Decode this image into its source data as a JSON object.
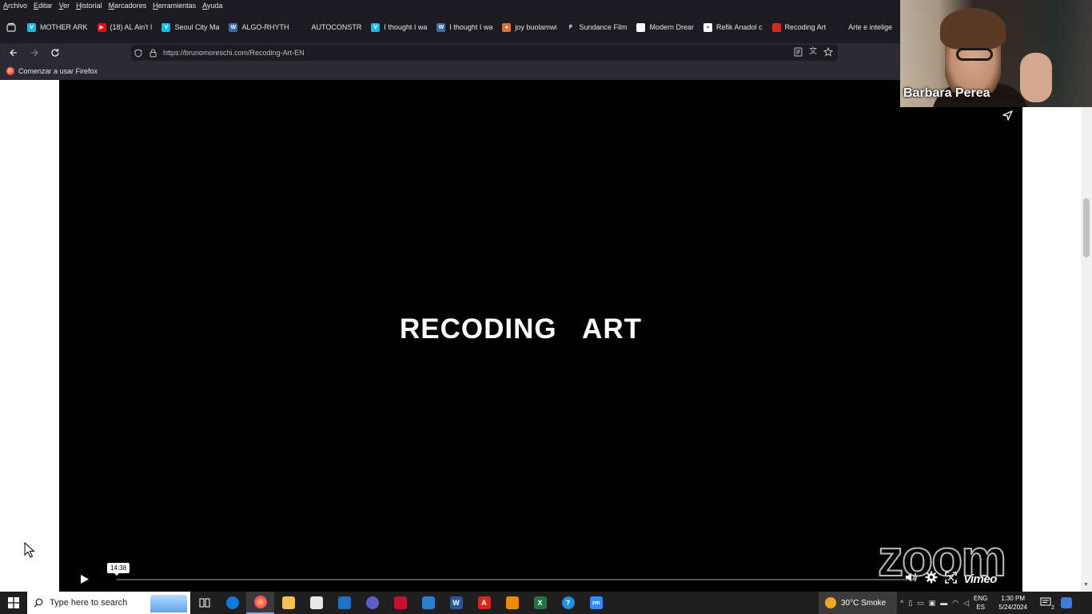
{
  "browser": {
    "menu": [
      "Archivo",
      "Editar",
      "Ver",
      "Historial",
      "Marcadores",
      "Herramientas",
      "Ayuda"
    ],
    "tabs": [
      {
        "label": "MOTHER ARK",
        "icon": "vimeo-icon",
        "color": "#1ab7ea",
        "glyph": "V"
      },
      {
        "label": "(18) AL Ain't I",
        "icon": "youtube-icon",
        "color": "#ff0000",
        "glyph": "▶"
      },
      {
        "label": "Seoul City Ma",
        "icon": "vimeo-icon",
        "color": "#1ab7ea",
        "glyph": "V"
      },
      {
        "label": "ALGO-RHYTH",
        "icon": "wordpress-icon",
        "color": "#3a6ea5",
        "glyph": "W"
      },
      {
        "label": "AUTOCONSTR",
        "icon": "page-icon",
        "color": "#1c1b22",
        "glyph": ""
      },
      {
        "label": "I thought I wa",
        "icon": "vimeo-icon",
        "color": "#1ab7ea",
        "glyph": "V"
      },
      {
        "label": "I thought I wa",
        "icon": "wordpress-icon",
        "color": "#3a6ea5",
        "glyph": "W"
      },
      {
        "label": "joy buolamwi",
        "icon": "site-icon",
        "color": "#e0702a",
        "glyph": "●"
      },
      {
        "label": "Sundance Film",
        "icon": "sundance-icon",
        "color": "#1c1b22",
        "glyph": "F"
      },
      {
        "label": "Modern Drear",
        "icon": "page-icon",
        "color": "#ffffff",
        "glyph": ""
      },
      {
        "label": "Refik Anadol c",
        "icon": "site-icon",
        "color": "#ffffff",
        "glyph": "▪"
      },
      {
        "label": "Recoding Art",
        "icon": "site-icon",
        "color": "#d9281b",
        "glyph": ""
      },
      {
        "label": "Arte e intelige",
        "icon": "page-icon",
        "color": "#1c1b22",
        "glyph": ""
      }
    ],
    "url": "https://brunomoreschi.com/Recoding-Art-EN",
    "bookmark": "Comenzar a usar Firefox"
  },
  "video": {
    "title": "RECODING ART",
    "time_tooltip": "14:38",
    "progress": 0.0,
    "brand": "vimeo"
  },
  "zoom": {
    "participant_name": "Barbara Perea",
    "watermark": "zoom"
  },
  "taskbar": {
    "search_placeholder": "Type here to search",
    "weather": "30°C Smoke",
    "lang_top": "ENG",
    "lang_bottom": "ES",
    "time": "1:30 PM",
    "date": "5/24/2024",
    "notification_count": "2"
  },
  "colors": {
    "browser_dark": "#1c1b22",
    "toolbar": "#2b2a33",
    "accent": "#1ab7ea"
  }
}
